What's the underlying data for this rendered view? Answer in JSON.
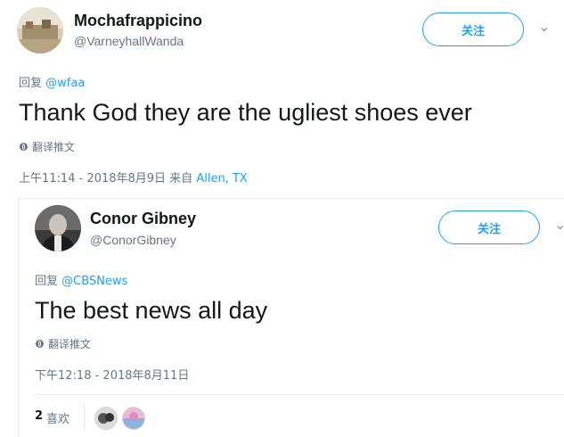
{
  "tweet1": {
    "name": "Mochafrappicino",
    "handle": "@VarneyhallWanda",
    "follow_label": "关注",
    "reply_prefix": "回复",
    "reply_mention": "@wfaa",
    "text": "Thank God they are the ugliest shoes ever",
    "translate_label": "翻译推文",
    "timestamp": "上午11:14 - 2018年8月9日 来自",
    "location": "Allen, TX"
  },
  "tweet2": {
    "name": "Conor Gibney",
    "handle": "@ConorGibney",
    "follow_label": "关注",
    "reply_prefix": "回复",
    "reply_mention": "@CBSNews",
    "text": "The best news all day",
    "translate_label": "翻译推文",
    "timestamp": "下午12:18 - 2018年8月11日",
    "likes_count": "2",
    "likes_label": "喜欢"
  },
  "colors": {
    "accent": "#1da1f2",
    "secondary_text": "#657786",
    "divider": "#e6ecf0"
  },
  "icons": [
    "globe-icon",
    "chevron-down-icon"
  ]
}
